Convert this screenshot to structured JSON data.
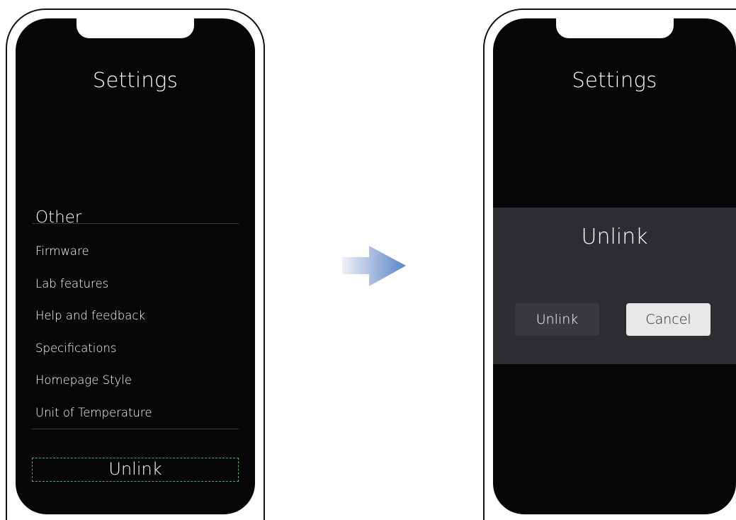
{
  "left_screen": {
    "title": "Settings",
    "section_header": "Other",
    "menu_items": [
      {
        "label": "Firmware"
      },
      {
        "label": "Lab features"
      },
      {
        "label": "Help and feedback"
      },
      {
        "label": "Specifications"
      },
      {
        "label": "Homepage Style"
      },
      {
        "label": "Unit of Temperature"
      }
    ],
    "unlink_label": "Unlink",
    "highlight_color": "#4caf50"
  },
  "right_screen": {
    "title": "Settings",
    "dialog": {
      "title": "Unlink",
      "confirm_label": "Unlink",
      "cancel_label": "Cancel"
    }
  },
  "transition_icon": "arrow-right-icon",
  "colors": {
    "screen_bg": "#060606",
    "dialog_bg": "#2d2c30",
    "arrow_start": "#eef1f7",
    "arrow_end": "#5b82c7"
  }
}
